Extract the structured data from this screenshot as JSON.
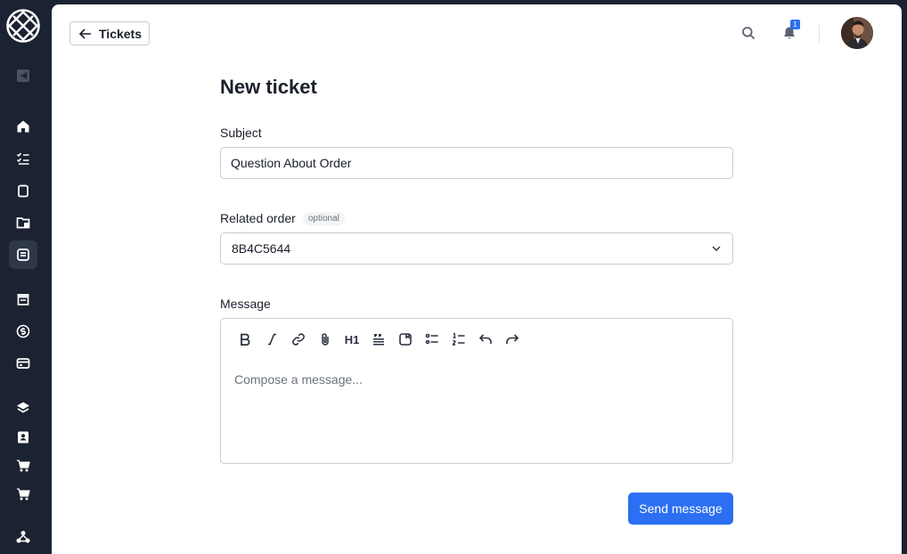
{
  "header": {
    "back_label": "Tickets",
    "notification_count": "1"
  },
  "form": {
    "title": "New ticket",
    "subject": {
      "label": "Subject",
      "value": "Question About Order"
    },
    "related_order": {
      "label": "Related order",
      "optional_tag": "optional",
      "value": "8B4C5644"
    },
    "message": {
      "label": "Message",
      "placeholder": "Compose a message...",
      "toolbar": [
        "bold",
        "italic",
        "link",
        "attachment",
        "H1",
        "blockquote",
        "code-block",
        "bullet-list",
        "ordered-list",
        "undo",
        "redo"
      ],
      "h1_label": "H1"
    },
    "submit_label": "Send message"
  },
  "sidebar": {
    "items": [
      "collapse",
      "home",
      "tasks",
      "orders",
      "folders",
      "tickets",
      "store",
      "billing",
      "payment-card",
      "layers",
      "contacts",
      "cart",
      "cart-2",
      "integrations"
    ],
    "active": "tickets"
  },
  "colors": {
    "sidebar_bg": "#1b2231",
    "primary": "#2d6ff2",
    "border": "#c9ccd2"
  }
}
